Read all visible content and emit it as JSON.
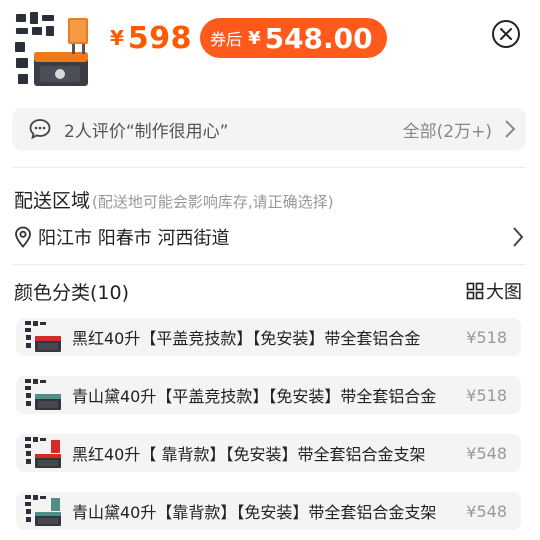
{
  "header": {
    "price_currency": "¥",
    "price_value": "598",
    "coupon_label": "券后",
    "coupon_currency": "¥",
    "coupon_value": "548.00",
    "accent_color": "#ff5a00",
    "close_icon": "close-circle-icon"
  },
  "review": {
    "icon": "chat-bubble-icon",
    "text": "2人评价“制作很用心”",
    "all_label": "全部(2万+)"
  },
  "delivery": {
    "title": "配送区域",
    "note": "(配送地可能会影响库存,请正确选择)",
    "address": "阳江市 阳春市 河西街道"
  },
  "colors": {
    "heading": "颜色分类(10)",
    "big_view_label": "大图",
    "options": [
      {
        "name": "黑红40升【平盖竞技款】【免安装】带全套铝合金",
        "price": "¥518"
      },
      {
        "name": "青山黛40升【平盖竞技款】【免安装】带全套铝合金",
        "price": "¥518"
      },
      {
        "name": "黑红40升【 靠背款】【免安装】带全套铝合金支架",
        "price": "¥548"
      },
      {
        "name": "青山黛40升【靠背款】【免安装】带全套铝合金支架",
        "price": "¥548"
      }
    ]
  }
}
